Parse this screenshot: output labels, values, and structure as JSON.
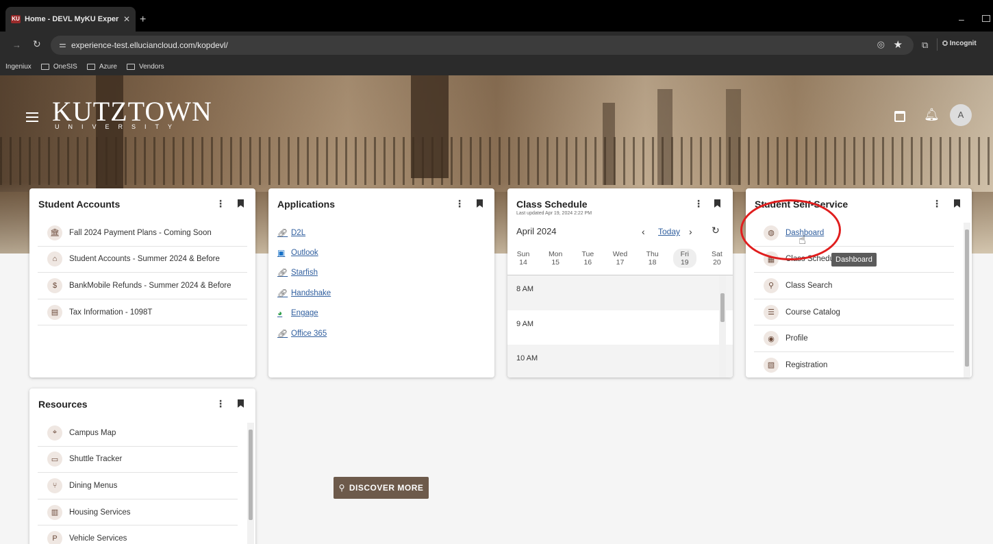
{
  "browser": {
    "tab_title": "Home - DEVL MyKU Experienc",
    "tab_favicon": "KU",
    "new_tab": "+",
    "url": "experience-test.elluciancloud.com/kopdevl/",
    "incognito_label": "Incognit",
    "bookmarks": [
      "Ingeniux",
      "OneSIS",
      "Azure",
      "Vendors"
    ]
  },
  "header": {
    "logo_main": "KUTZTOWN",
    "logo_sub": "UNIVERSITY",
    "avatar_initial": "A"
  },
  "cards": {
    "student_accounts": {
      "title": "Student Accounts",
      "items": [
        {
          "label": "Fall 2024 Payment Plans - Coming Soon",
          "icon": "bank-icon"
        },
        {
          "label": "Student Accounts - Summer 2024 & Before",
          "icon": "building-icon"
        },
        {
          "label": "BankMobile Refunds - Summer 2024 & Before",
          "icon": "dollar-icon"
        },
        {
          "label": "Tax Information - 1098T",
          "icon": "document-icon"
        }
      ]
    },
    "applications": {
      "title": "Applications",
      "items": [
        {
          "label": "D2L",
          "icon": "link-icon"
        },
        {
          "label": "Outlook",
          "icon": "outlook-icon"
        },
        {
          "label": "Starfish",
          "icon": "link-icon"
        },
        {
          "label": "Handshake",
          "icon": "link-icon"
        },
        {
          "label": "Engage",
          "icon": "engage-icon"
        },
        {
          "label": "Office 365",
          "icon": "link-icon"
        }
      ]
    },
    "class_schedule": {
      "title": "Class Schedule",
      "updated": "Last updated Apr 19, 2024 2:22 PM",
      "month": "April 2024",
      "today_label": "Today",
      "days": [
        {
          "name": "Sun",
          "num": "14"
        },
        {
          "name": "Mon",
          "num": "15"
        },
        {
          "name": "Tue",
          "num": "16"
        },
        {
          "name": "Wed",
          "num": "17"
        },
        {
          "name": "Thu",
          "num": "18"
        },
        {
          "name": "Fri",
          "num": "19"
        },
        {
          "name": "Sat",
          "num": "20"
        }
      ],
      "hours": [
        "8 AM",
        "9 AM",
        "10 AM"
      ]
    },
    "student_self_service": {
      "title": "Student Self-Service",
      "items": [
        {
          "label": "Dashboard",
          "icon": "globe-icon"
        },
        {
          "label": "Class Schedule",
          "icon": "calendar-icon"
        },
        {
          "label": "Class Search",
          "icon": "search-icon"
        },
        {
          "label": "Course Catalog",
          "icon": "list-icon"
        },
        {
          "label": "Profile",
          "icon": "profile-icon"
        },
        {
          "label": "Registration",
          "icon": "clipboard-icon"
        }
      ],
      "tooltip": "Dashboard"
    },
    "resources": {
      "title": "Resources",
      "items": [
        {
          "label": "Campus Map",
          "icon": "map-icon"
        },
        {
          "label": "Shuttle Tracker",
          "icon": "bus-icon"
        },
        {
          "label": "Dining Menus",
          "icon": "dining-icon"
        },
        {
          "label": "Housing Services",
          "icon": "housing-icon"
        },
        {
          "label": "Vehicle Services",
          "icon": "parking-icon"
        }
      ]
    }
  },
  "discover_more": "DISCOVER MORE",
  "colors": {
    "brand_brown": "#6d5a4b",
    "link_blue": "#2f5e9e",
    "annotation_red": "#e01e1e"
  }
}
